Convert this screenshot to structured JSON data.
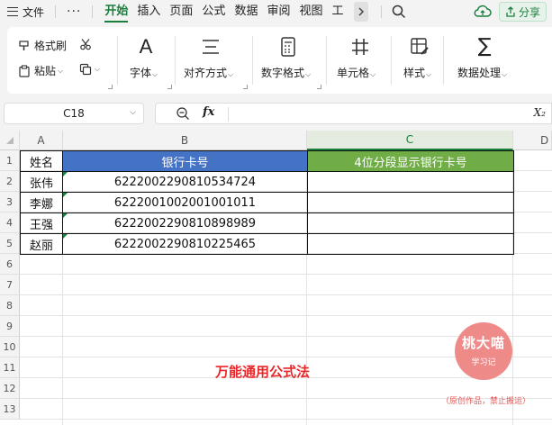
{
  "menu": {
    "file_label": "文件",
    "more_label": "···",
    "tabs": [
      "开始",
      "插入",
      "页面",
      "公式",
      "数据",
      "审阅",
      "视图",
      "工具"
    ],
    "active_tab": "开始",
    "share_label": "分享"
  },
  "ribbon": {
    "format_painter": "格式刷",
    "paste": "粘贴",
    "font": "字体",
    "align": "对齐方式",
    "number_format": "数字格式",
    "cells": "单元格",
    "styles": "样式",
    "data_processing": "数据处理"
  },
  "formula_bar": {
    "name_box": "C18",
    "fx": "fx",
    "value": ""
  },
  "sheet": {
    "columns": [
      "A",
      "B",
      "C",
      "D"
    ],
    "selected_column": "C",
    "rows": [
      "1",
      "2",
      "3",
      "4",
      "5",
      "6",
      "7",
      "8",
      "9",
      "10",
      "11",
      "12",
      "13"
    ],
    "header": {
      "a": "姓名",
      "b": "银行卡号",
      "c": "4位分段显示银行卡号"
    },
    "data": [
      {
        "name": "张伟",
        "card": "6222002290810534724",
        "split": ""
      },
      {
        "name": "李娜",
        "card": "6222001002001001011",
        "split": ""
      },
      {
        "name": "王强",
        "card": "6222002290810898989",
        "split": ""
      },
      {
        "name": "赵丽",
        "card": "6222002290810225465",
        "split": ""
      }
    ]
  },
  "caption": "万能通用公式法",
  "watermark": {
    "title": "桃大喵",
    "subtitle": "学习记",
    "note": "（原创作品，禁止搬运）"
  },
  "colors": {
    "accent": "#1a7f3c",
    "header_blue": "#4472c4",
    "header_green": "#70ad47",
    "caption_red": "#e8272a",
    "stamp_pink": "#ee8a88"
  }
}
